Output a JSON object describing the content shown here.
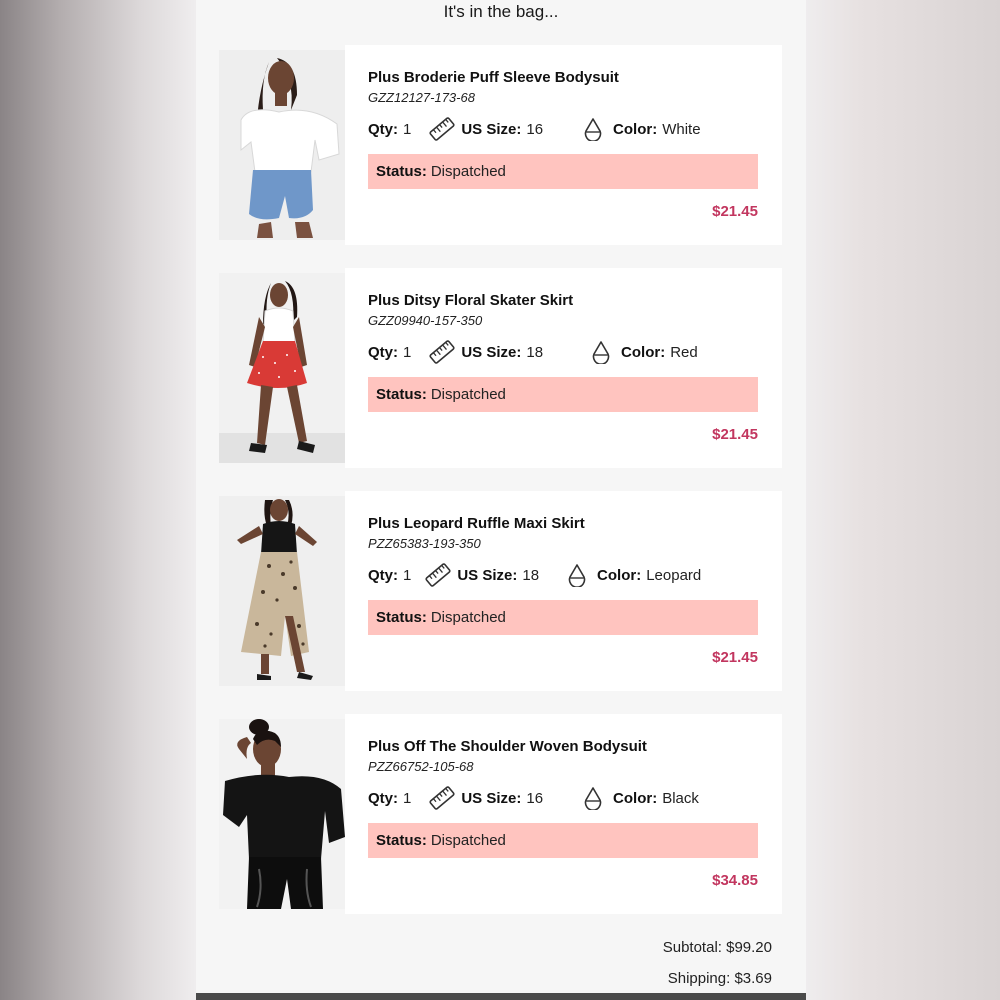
{
  "heading": "It's in the bag...",
  "labels": {
    "qty": "Qty:",
    "size": "US Size:",
    "color": "Color:",
    "status": "Status:"
  },
  "icons": {
    "size": "ruler-icon",
    "color": "drop-icon"
  },
  "items": [
    {
      "name": "Plus Broderie Puff Sleeve Bodysuit",
      "sku": "GZZ12127-173-68",
      "qty": "1",
      "size": "16",
      "color": "White",
      "status": "Dispatched",
      "price": "$21.45"
    },
    {
      "name": "Plus Ditsy Floral Skater Skirt",
      "sku": "GZZ09940-157-350",
      "qty": "1",
      "size": "18",
      "color": "Red",
      "status": "Dispatched",
      "price": "$21.45"
    },
    {
      "name": "Plus Leopard Ruffle Maxi Skirt",
      "sku": "PZZ65383-193-350",
      "qty": "1",
      "size": "18",
      "color": "Leopard",
      "status": "Dispatched",
      "price": "$21.45"
    },
    {
      "name": "Plus Off The Shoulder Woven Bodysuit",
      "sku": "PZZ66752-105-68",
      "qty": "1",
      "size": "16",
      "color": "Black",
      "status": "Dispatched",
      "price": "$34.85"
    }
  ],
  "totals": {
    "subtotal": "Subtotal: $99.20",
    "shipping": "Shipping: $3.69"
  },
  "colors": {
    "status_bg": "#ffc4bf",
    "price": "#c2365f",
    "panel_bg": "#f6f6f6"
  }
}
